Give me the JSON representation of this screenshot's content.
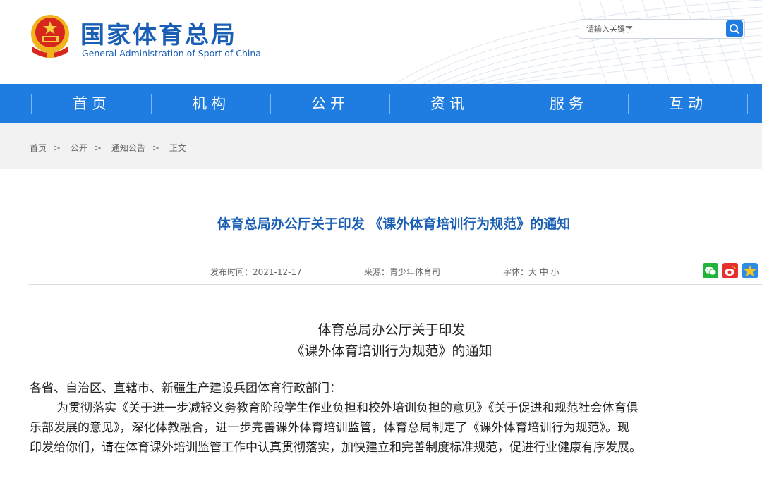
{
  "header": {
    "site_name_cn": "国家体育总局",
    "site_name_en": "General Administration of Sport of China",
    "search_placeholder": "请输入关键字"
  },
  "nav": [
    "首页",
    "机构",
    "公开",
    "资讯",
    "服务",
    "互动"
  ],
  "breadcrumb": [
    "首页",
    "公开",
    "通知公告",
    "正文"
  ],
  "article": {
    "title": "体育总局办公厅关于印发 《课外体育培训行为规范》的通知",
    "publish_time": "发布时间：2021-12-17",
    "source": "来源：青少年体育司",
    "font_size": "字体：大 中 小",
    "doc_title_line1": "体育总局办公厅关于印发",
    "doc_title_line2": "《课外体育培训行为规范》的通知",
    "salutation": "各省、自治区、直辖市、新疆生产建设兵团体育行政部门：",
    "body_line1": "为贯彻落实《关于进一步减轻义务教育阶段学生作业负担和校外培训负担的意见》《关于促进和规范社会体育俱",
    "body_line2": "乐部发展的意见》，深化体教融合，进一步完善课外体育培训监管，体育总局制定了《课外体育培训行为规范》。现",
    "body_line3": "印发给你们，请在体育课外培训监管工作中认真贯彻落实，加快建立和完善制度标准规范，促进行业健康有序发展。"
  },
  "share_icons": [
    "wechat-icon",
    "weibo-icon",
    "qzone-icon"
  ],
  "colors": {
    "brand_blue": "#1a5fb4",
    "nav_blue": "#1f7ce0"
  }
}
